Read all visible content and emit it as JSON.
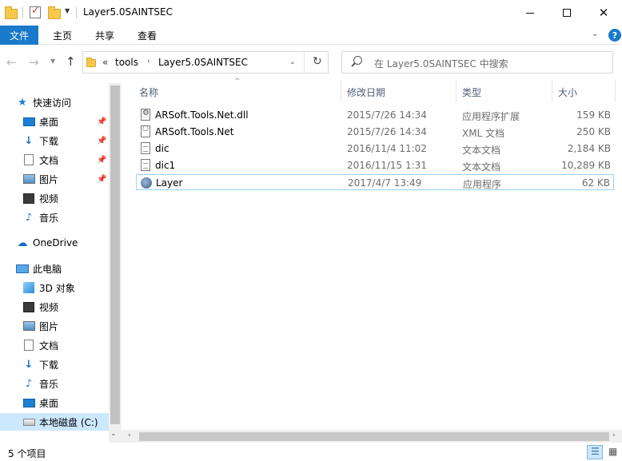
{
  "window": {
    "title": "Layer5.0SAINTSEC"
  },
  "ribbon": {
    "tabs": [
      {
        "label": "文件"
      },
      {
        "label": "主页"
      },
      {
        "label": "共享"
      },
      {
        "label": "查看"
      }
    ],
    "help": "?"
  },
  "address": {
    "overflow": "«",
    "crumbs": [
      "tools",
      "Layer5.0SAINTSEC"
    ]
  },
  "search": {
    "placeholder": "在 Layer5.0SAINTSEC 中搜索"
  },
  "sidebar": {
    "quick_access": "快速访问",
    "quick_items": [
      {
        "label": "桌面",
        "icon": "desktop-icon"
      },
      {
        "label": "下载",
        "icon": "download-icon"
      },
      {
        "label": "文档",
        "icon": "document-icon"
      },
      {
        "label": "图片",
        "icon": "picture-icon"
      },
      {
        "label": "视频",
        "icon": "video-icon"
      },
      {
        "label": "音乐",
        "icon": "music-icon"
      }
    ],
    "onedrive": "OneDrive",
    "this_pc": "此电脑",
    "pc_items": [
      {
        "label": "3D 对象",
        "icon": "3d-objects-icon"
      },
      {
        "label": "视频",
        "icon": "video-icon"
      },
      {
        "label": "图片",
        "icon": "picture-icon"
      },
      {
        "label": "文档",
        "icon": "document-icon"
      },
      {
        "label": "下载",
        "icon": "download-icon"
      },
      {
        "label": "音乐",
        "icon": "music-icon"
      },
      {
        "label": "桌面",
        "icon": "desktop-icon"
      },
      {
        "label": "本地磁盘 (C:)",
        "icon": "drive-icon"
      }
    ]
  },
  "columns": {
    "name": "名称",
    "date": "修改日期",
    "type": "类型",
    "size": "大小"
  },
  "files": [
    {
      "name": "ARSoft.Tools.Net.dll",
      "date": "2015/7/26 14:34",
      "type": "应用程序扩展",
      "size": "159 KB",
      "icon": "dll-file-icon"
    },
    {
      "name": "ARSoft.Tools.Net",
      "date": "2015/7/26 14:34",
      "type": "XML 文档",
      "size": "250 KB",
      "icon": "xml-file-icon"
    },
    {
      "name": "dic",
      "date": "2016/11/4 11:02",
      "type": "文本文档",
      "size": "2,184 KB",
      "icon": "text-file-icon"
    },
    {
      "name": "dic1",
      "date": "2016/11/15 1:31",
      "type": "文本文档",
      "size": "10,289 KB",
      "icon": "text-file-icon"
    },
    {
      "name": "Layer",
      "date": "2017/4/7 13:49",
      "type": "应用程序",
      "size": "62 KB",
      "icon": "application-icon"
    }
  ],
  "status": {
    "count": "5 个项目"
  }
}
